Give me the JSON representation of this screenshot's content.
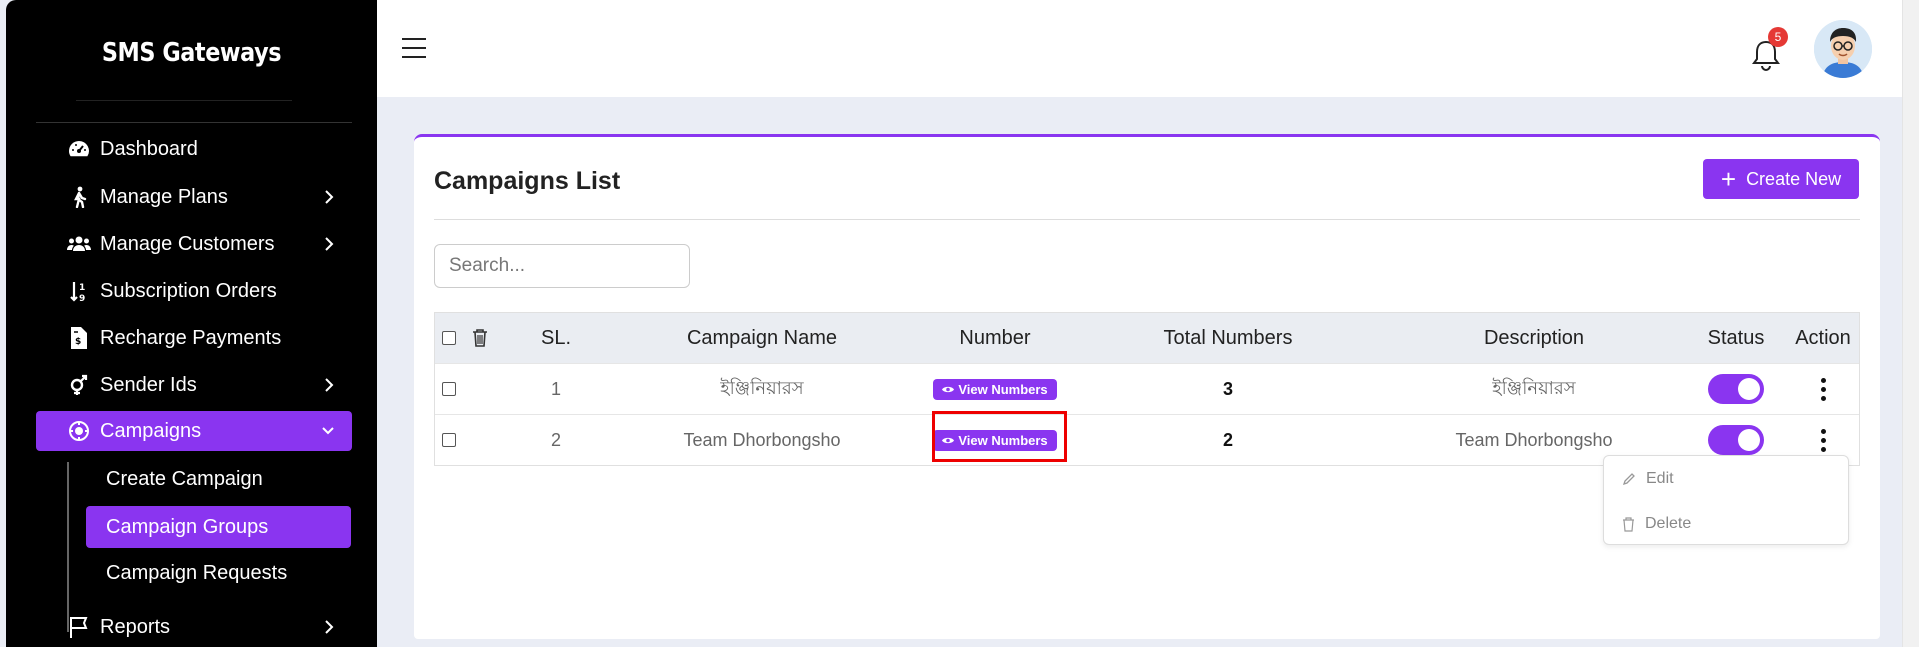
{
  "sidebar": {
    "brand": "SMS Gateways",
    "items": [
      {
        "label": "Dashboard",
        "icon": "gauge-icon"
      },
      {
        "label": "Manage Plans",
        "icon": "walking-icon"
      },
      {
        "label": "Manage Customers",
        "icon": "users-icon"
      },
      {
        "label": "Subscription Orders",
        "icon": "sort-icon"
      },
      {
        "label": "Recharge Payments",
        "icon": "invoice-icon"
      },
      {
        "label": "Sender Ids",
        "icon": "gender-icon"
      },
      {
        "label": "Campaigns",
        "icon": "campaign-icon"
      },
      {
        "label": "Reports",
        "icon": "flag-icon"
      }
    ],
    "subitems": [
      "Create Campaign",
      "Campaign Groups",
      "Campaign Requests"
    ]
  },
  "topbar": {
    "notification_count": "5"
  },
  "main": {
    "title": "Campaigns List",
    "create_label": "Create New",
    "search_placeholder": "Search...",
    "columns": [
      "SL.",
      "Campaign Name",
      "Number",
      "Total Numbers",
      "Description",
      "Status",
      "Action"
    ],
    "view_numbers_label": "View Numbers",
    "rows": [
      {
        "sl": "1",
        "name": "ইঞ্জিনিয়ারস",
        "total": "3",
        "description": "ইঞ্জিনিয়ারস",
        "status": true
      },
      {
        "sl": "2",
        "name": "Team Dhorbongsho",
        "total": "2",
        "description": "Team Dhorbongsho",
        "status": true
      }
    ],
    "action_menu": {
      "edit": "Edit",
      "delete": "Delete"
    }
  },
  "colors": {
    "accent": "#8a35f0",
    "sidebar_bg": "#000000",
    "page_bg": "#eaedf5",
    "badge": "#e53935",
    "highlight": "#ee0000"
  }
}
